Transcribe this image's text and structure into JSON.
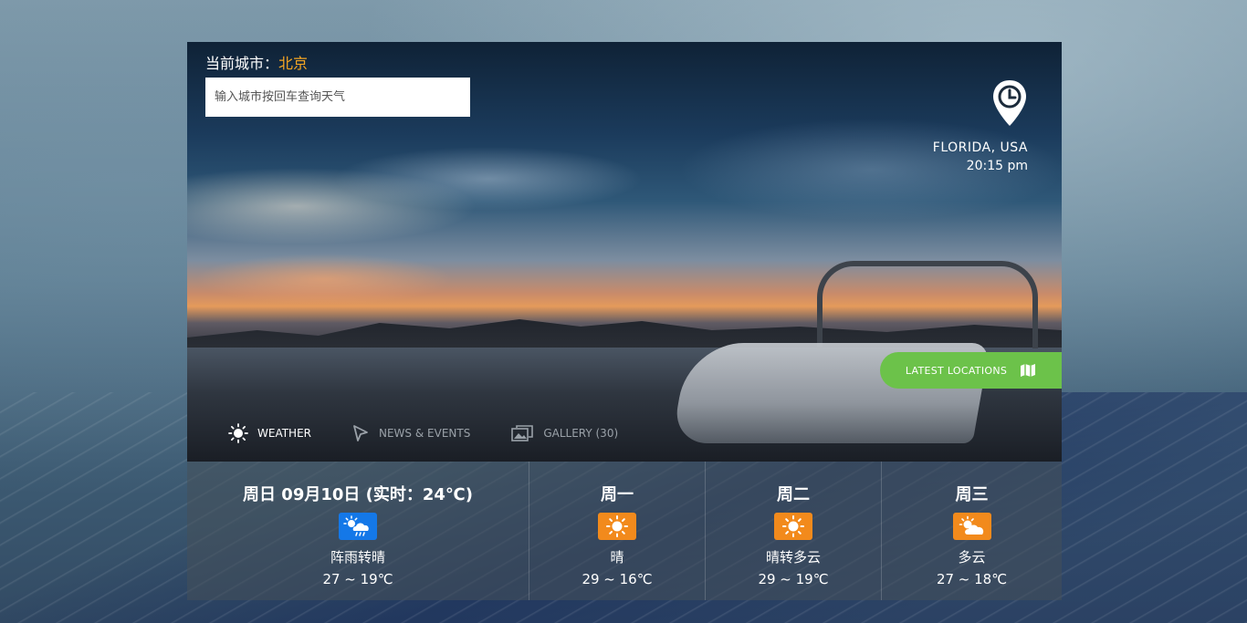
{
  "header": {
    "city_label": "当前城市：",
    "city_name": "北京",
    "search_placeholder": "输入城市按回车查询天气"
  },
  "location": {
    "icon": "location-clock-pin-icon",
    "name": "FLORIDA, USA",
    "time": "20:15 pm"
  },
  "latest_button": {
    "label": "LATEST LOCATIONS",
    "icon": "map-icon",
    "color": "#6cc24a"
  },
  "tabs": [
    {
      "label": "WEATHER",
      "icon": "sun-icon",
      "active": true
    },
    {
      "label": "NEWS & EVENTS",
      "icon": "cursor-icon",
      "active": false
    },
    {
      "label": "GALLERY (30)",
      "icon": "gallery-icon",
      "active": false
    }
  ],
  "forecast": [
    {
      "title": "周日 09月10日 (实时：24℃)",
      "condition": "阵雨转晴",
      "temp": "27 ~ 19℃",
      "icon": "shower-to-sunny-icon",
      "icon_color": "#1478e8"
    },
    {
      "title": "周一",
      "condition": "晴",
      "temp": "29 ~ 16℃",
      "icon": "sunny-icon",
      "icon_color": "#f28a1c"
    },
    {
      "title": "周二",
      "condition": "晴转多云",
      "temp": "29 ~ 19℃",
      "icon": "sunny-icon",
      "icon_color": "#f28a1c"
    },
    {
      "title": "周三",
      "condition": "多云",
      "temp": "27 ~ 18℃",
      "icon": "partly-cloudy-icon",
      "icon_color": "#f28a1c"
    }
  ],
  "colors": {
    "accent_city": "#f5a623",
    "weather_blue": "#1478e8",
    "weather_orange": "#f28a1c"
  }
}
